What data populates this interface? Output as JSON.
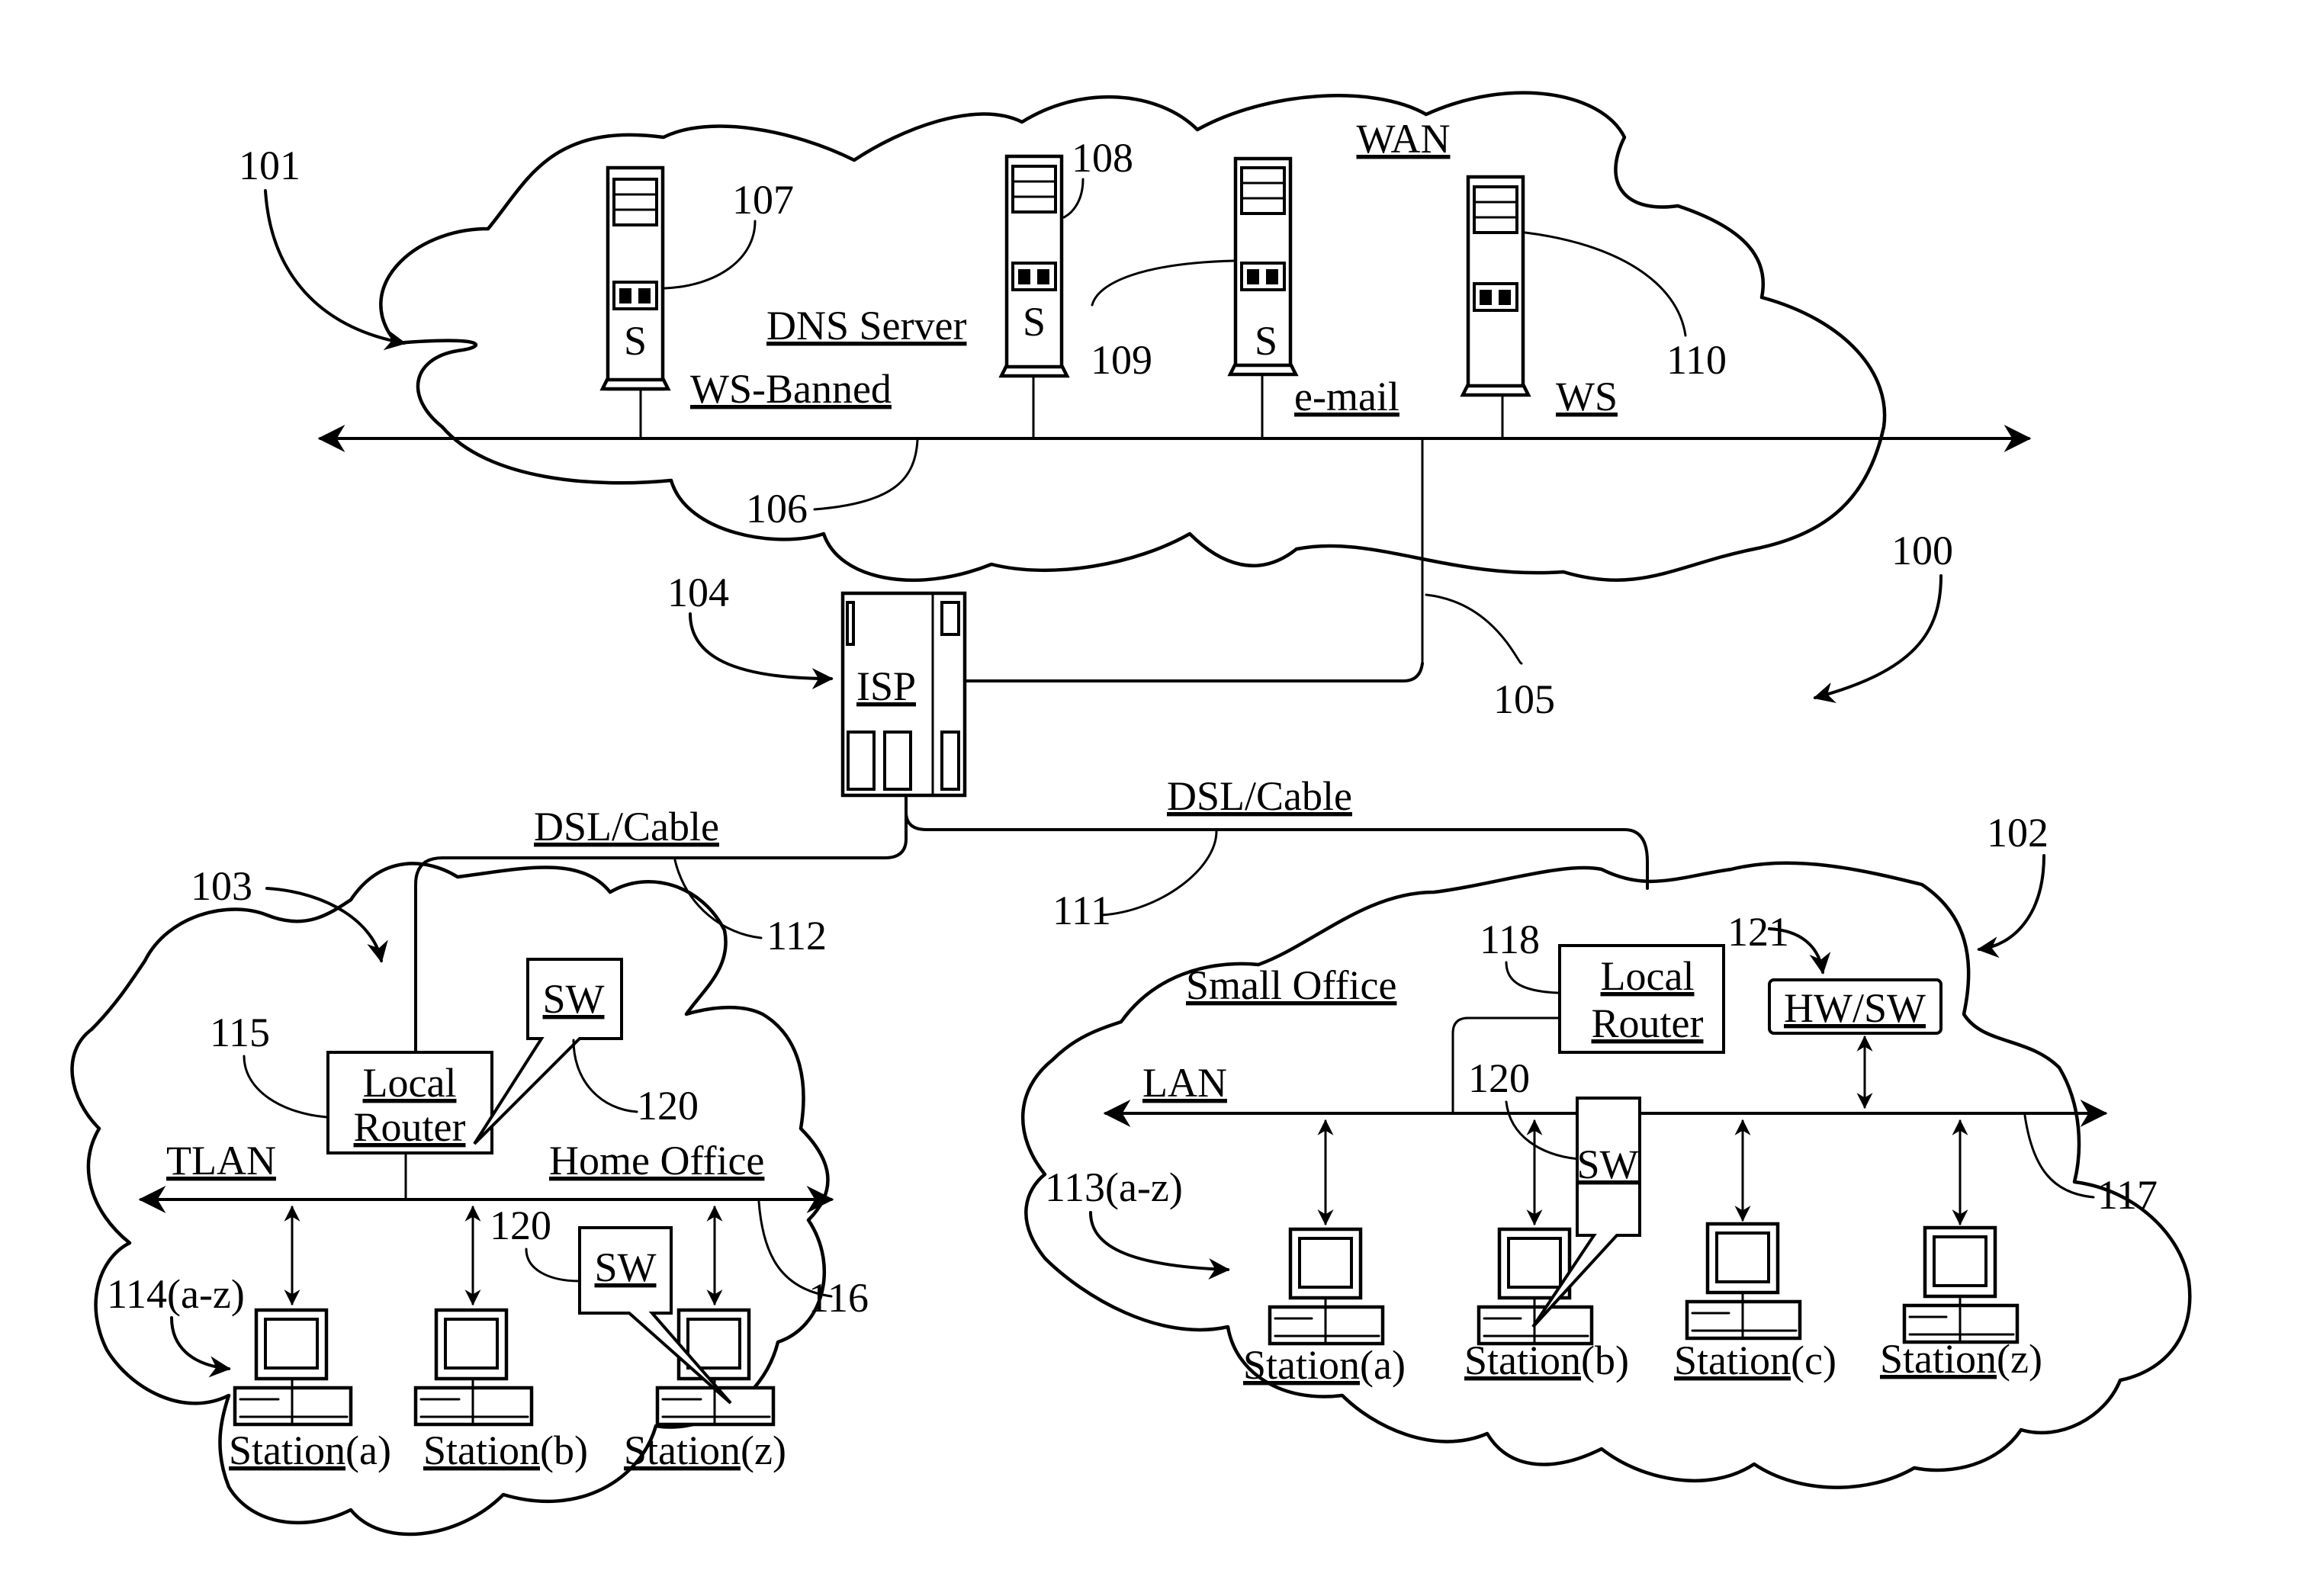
{
  "figure": {
    "overall_ref": "100",
    "wan": {
      "ref": "101",
      "label": "WAN",
      "bus_ref": "106",
      "uplink_ref": "105",
      "servers": [
        {
          "ref": "107",
          "glyph": "S",
          "label": "WS-Banned"
        },
        {
          "ref": "108",
          "glyph": "S",
          "label": "DNS Server"
        },
        {
          "ref": "109",
          "glyph": "S",
          "label": "e-mail"
        },
        {
          "ref": "110",
          "glyph": "",
          "label": "WS"
        }
      ]
    },
    "isp": {
      "ref": "104",
      "label": "ISP"
    },
    "links": [
      {
        "ref": "112",
        "label": "DSL/Cable"
      },
      {
        "ref": "111",
        "label": "DSL/Cable"
      }
    ],
    "home_office": {
      "ref": "103",
      "title": "Home Office",
      "lan_label": "TLAN",
      "lan_ref": "116",
      "router": {
        "ref": "115",
        "line1": "Local",
        "line2": "Router"
      },
      "sw_boxes": [
        {
          "ref": "120",
          "label": "SW"
        },
        {
          "ref": "120",
          "label": "SW"
        }
      ],
      "stations_ref": "114(a-z)",
      "stations": [
        {
          "name": "Station",
          "suffix": "(a)"
        },
        {
          "name": "Station",
          "suffix": "(b)"
        },
        {
          "name": "Station",
          "suffix": "(z)"
        }
      ]
    },
    "small_office": {
      "ref": "102",
      "title": "Small Office",
      "lan_label": "LAN",
      "lan_ref": "117",
      "router": {
        "ref": "118",
        "line1": "Local",
        "line2": "Router"
      },
      "hwsw": {
        "ref": "121",
        "label": "HW/SW"
      },
      "sw_box": {
        "ref": "120",
        "label": "SW"
      },
      "stations_ref": "113(a-z)",
      "stations": [
        {
          "name": "Station",
          "suffix": "(a)"
        },
        {
          "name": "Station",
          "suffix": "(b)"
        },
        {
          "name": "Station",
          "suffix": "(c)"
        },
        {
          "name": "Station",
          "suffix": "(z)"
        }
      ]
    }
  }
}
